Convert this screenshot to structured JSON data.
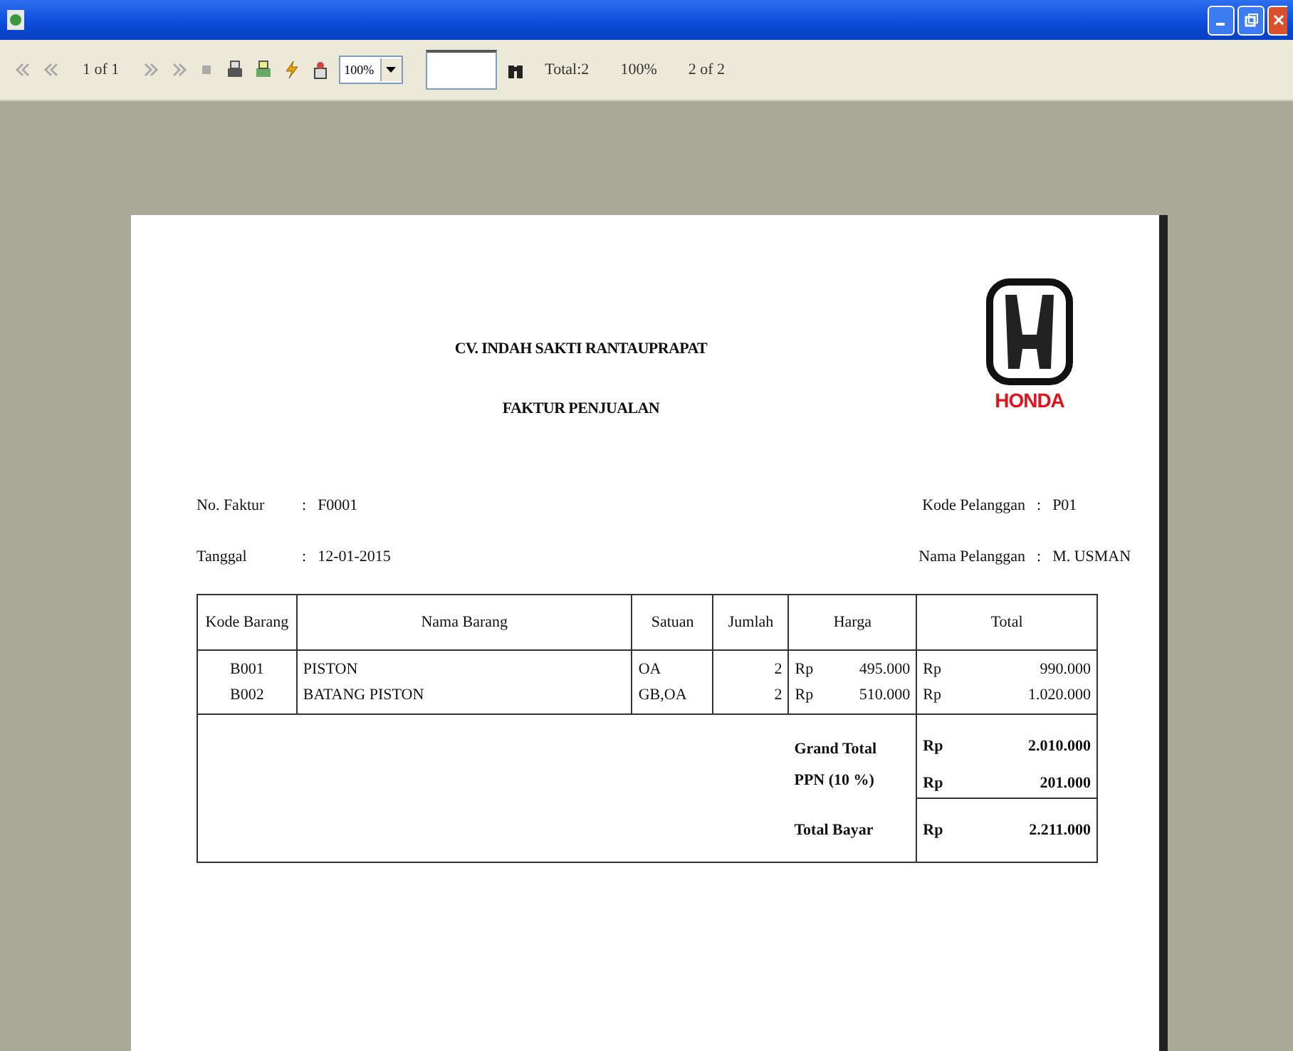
{
  "toolbar": {
    "page_indicator": "1 of 1",
    "zoom": "100%",
    "total": "Total:2",
    "zoom_percent": "100%",
    "page_count": "2 of 2"
  },
  "report": {
    "company": "CV. INDAH SAKTI RANTAUPRAPAT",
    "title": "FAKTUR PENJUALAN",
    "logo_text": "HONDA",
    "fields": [
      {
        "label": "No. Faktur",
        "separator": ":",
        "value": "F0001"
      },
      {
        "label": "Kode Pelanggan",
        "separator": ":",
        "value": "P01"
      },
      {
        "label": "Tanggal",
        "separator": ":",
        "value": "12-01-2015"
      },
      {
        "label": "Nama Pelanggan",
        "separator": ":",
        "value": "M. USMAN"
      }
    ],
    "columns": [
      "Kode Barang",
      "Nama Barang",
      "Satuan",
      "Jumlah",
      "Harga",
      "Total"
    ],
    "rows": [
      {
        "kode": "B001",
        "nama": "PISTON",
        "satuan": "OA",
        "jumlah": "2",
        "harga_currency": "Rp",
        "harga": "495.000",
        "total_currency": "Rp",
        "total": "990.000"
      },
      {
        "kode": "B002",
        "nama": "BATANG PISTON",
        "satuan": "GB,OA",
        "jumlah": "2",
        "harga_currency": "Rp",
        "harga": "510.000",
        "total_currency": "Rp",
        "total": "1.020.000"
      }
    ],
    "summary": [
      {
        "label": "Grand Total",
        "currency": "Rp",
        "value": "2.010.000"
      },
      {
        "label": "PPN (10 %)",
        "currency": "Rp",
        "value": "201.000"
      },
      {
        "label": "Total Bayar",
        "currency": "Rp",
        "value": "2.211.000"
      }
    ]
  }
}
